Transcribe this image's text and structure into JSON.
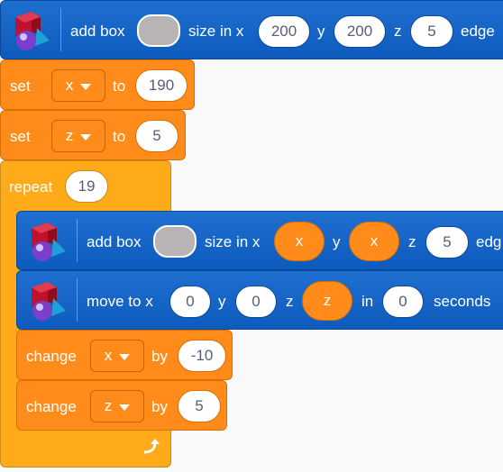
{
  "blocks": {
    "add_box_top": {
      "label": "add box",
      "size_label": "size in x",
      "x": "200",
      "y_label": "y",
      "y": "200",
      "z_label": "z",
      "z": "5",
      "edge_label": "edge"
    },
    "set_x": {
      "label": "set",
      "var": "x",
      "to_label": "to",
      "value": "190"
    },
    "set_z": {
      "label": "set",
      "var": "z",
      "to_label": "to",
      "value": "5"
    },
    "repeat": {
      "label": "repeat",
      "count": "19"
    },
    "add_box_inner": {
      "label": "add box",
      "size_label": "size in x",
      "x": "x",
      "y_label": "y",
      "y": "x",
      "z_label": "z",
      "z": "5",
      "edge_label": "edg"
    },
    "move_to": {
      "label": "move to x",
      "x": "0",
      "y_label": "y",
      "y": "0",
      "z_label": "z",
      "z": "z",
      "in_label": "in",
      "seconds": "0",
      "seconds_label": "seconds"
    },
    "change_x": {
      "label": "change",
      "var": "x",
      "by_label": "by",
      "value": "-10"
    },
    "change_z": {
      "label": "change",
      "var": "z",
      "by_label": "by",
      "value": "5"
    }
  },
  "colors": {
    "motion_blue": "#0d5bbd",
    "variables_orange": "#ff8c1a",
    "control_orange": "#ffab19"
  }
}
